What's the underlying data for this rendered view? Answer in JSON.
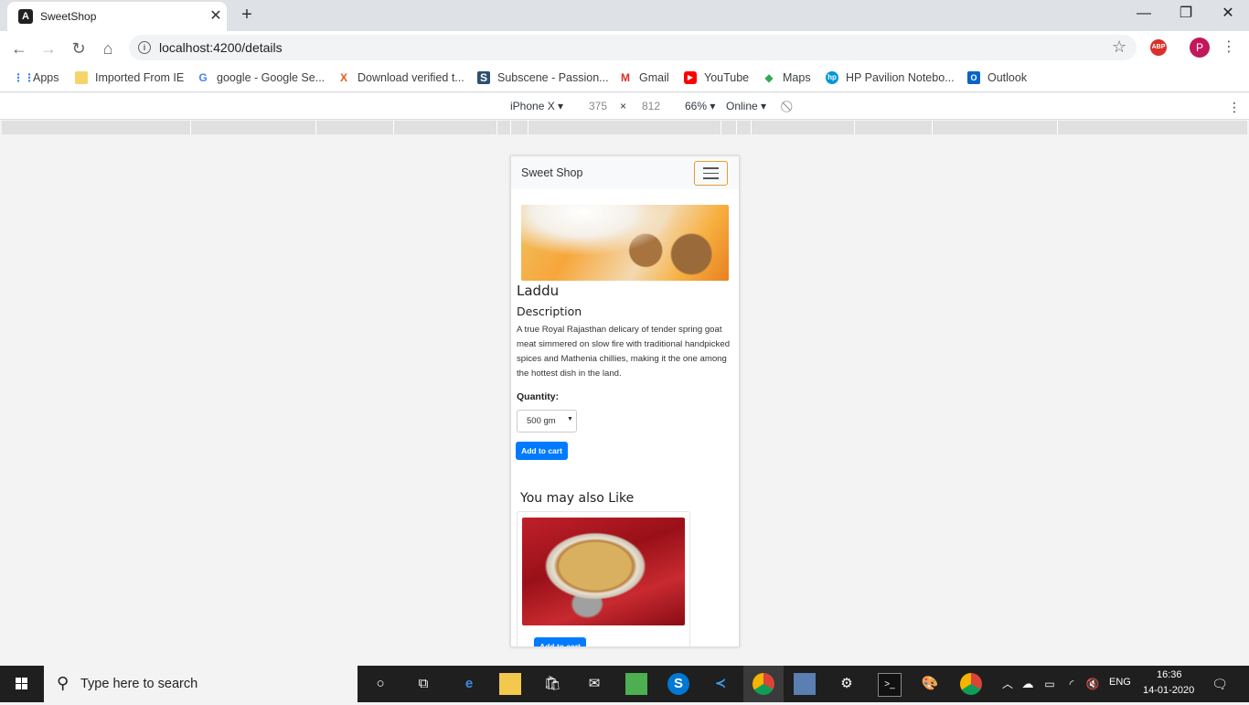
{
  "browser": {
    "tab_title": "SweetShop",
    "tab_favicon": "A",
    "url": "localhost:4200/details",
    "profile_initial": "P",
    "abp_label": "ABP"
  },
  "bookmarks": [
    {
      "label": "Apps",
      "icon": "apps-grid-icon"
    },
    {
      "label": "Imported From IE",
      "icon": "folder-icon"
    },
    {
      "label": "google - Google Se...",
      "icon": "google-icon"
    },
    {
      "label": "Download verified t...",
      "icon": "x-icon"
    },
    {
      "label": "Subscene - Passion...",
      "icon": "s-icon"
    },
    {
      "label": "Gmail",
      "icon": "gmail-icon"
    },
    {
      "label": "YouTube",
      "icon": "youtube-icon"
    },
    {
      "label": "Maps",
      "icon": "maps-icon"
    },
    {
      "label": "HP Pavilion Notebo...",
      "icon": "hp-icon"
    },
    {
      "label": "Outlook",
      "icon": "outlook-icon"
    }
  ],
  "devtools": {
    "device": "iPhone X",
    "width": "375",
    "times": "×",
    "height": "812",
    "zoom": "66%",
    "network": "Online"
  },
  "page": {
    "brand": "Sweet Shop",
    "product_name": "Laddu",
    "description_heading": "Description",
    "description": "A true Royal Rajasthan delicary of tender spring goat meat simmered on slow fire with traditional handpicked spices and Mathenia chillies, making it the one among the hottest dish in the land.",
    "quantity_label": "Quantity:",
    "quantity_value": "500 gm",
    "add_to_cart": "Add to cart",
    "also_like_heading": "You may also Like",
    "card_button": "Add to cart"
  },
  "taskbar": {
    "search_placeholder": "Type here to search",
    "language": "ENG",
    "time": "16:36",
    "date": "14-01-2020"
  }
}
